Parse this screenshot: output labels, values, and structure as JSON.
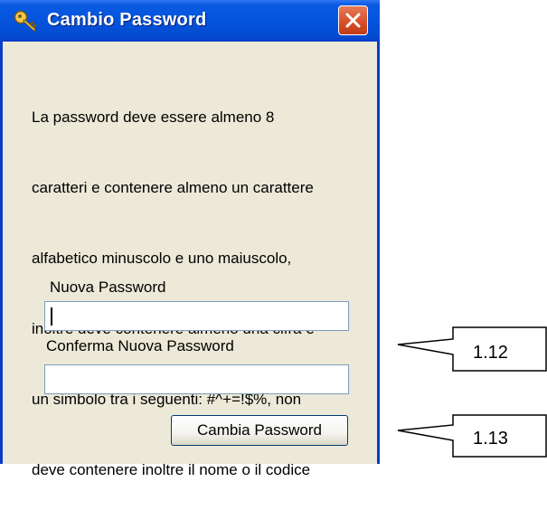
{
  "window": {
    "title": "Cambio Password",
    "description_lines": [
      "La password deve essere almeno 8",
      "caratteri e contenere almeno un carattere",
      "alfabetico minuscolo e uno maiuscolo,",
      "inoltre deve contenere almeno una cifra e",
      "un simbolo tra i seguenti: #^+=!$%, non",
      "deve contenere inoltre il nome o il codice"
    ],
    "new_password": {
      "label": "Nuova Password",
      "value": ""
    },
    "confirm_password": {
      "label": "Conferma Nuova Password",
      "value": ""
    },
    "submit_label": "Cambia Password"
  },
  "annotations": [
    {
      "label": "1.12"
    },
    {
      "label": "1.13"
    }
  ],
  "colors": {
    "titlebar": "#0453dd",
    "window_bg": "#ece9d8",
    "close_button": "#d8512c"
  },
  "icons": {
    "app": "key-icon",
    "close": "close-icon"
  }
}
